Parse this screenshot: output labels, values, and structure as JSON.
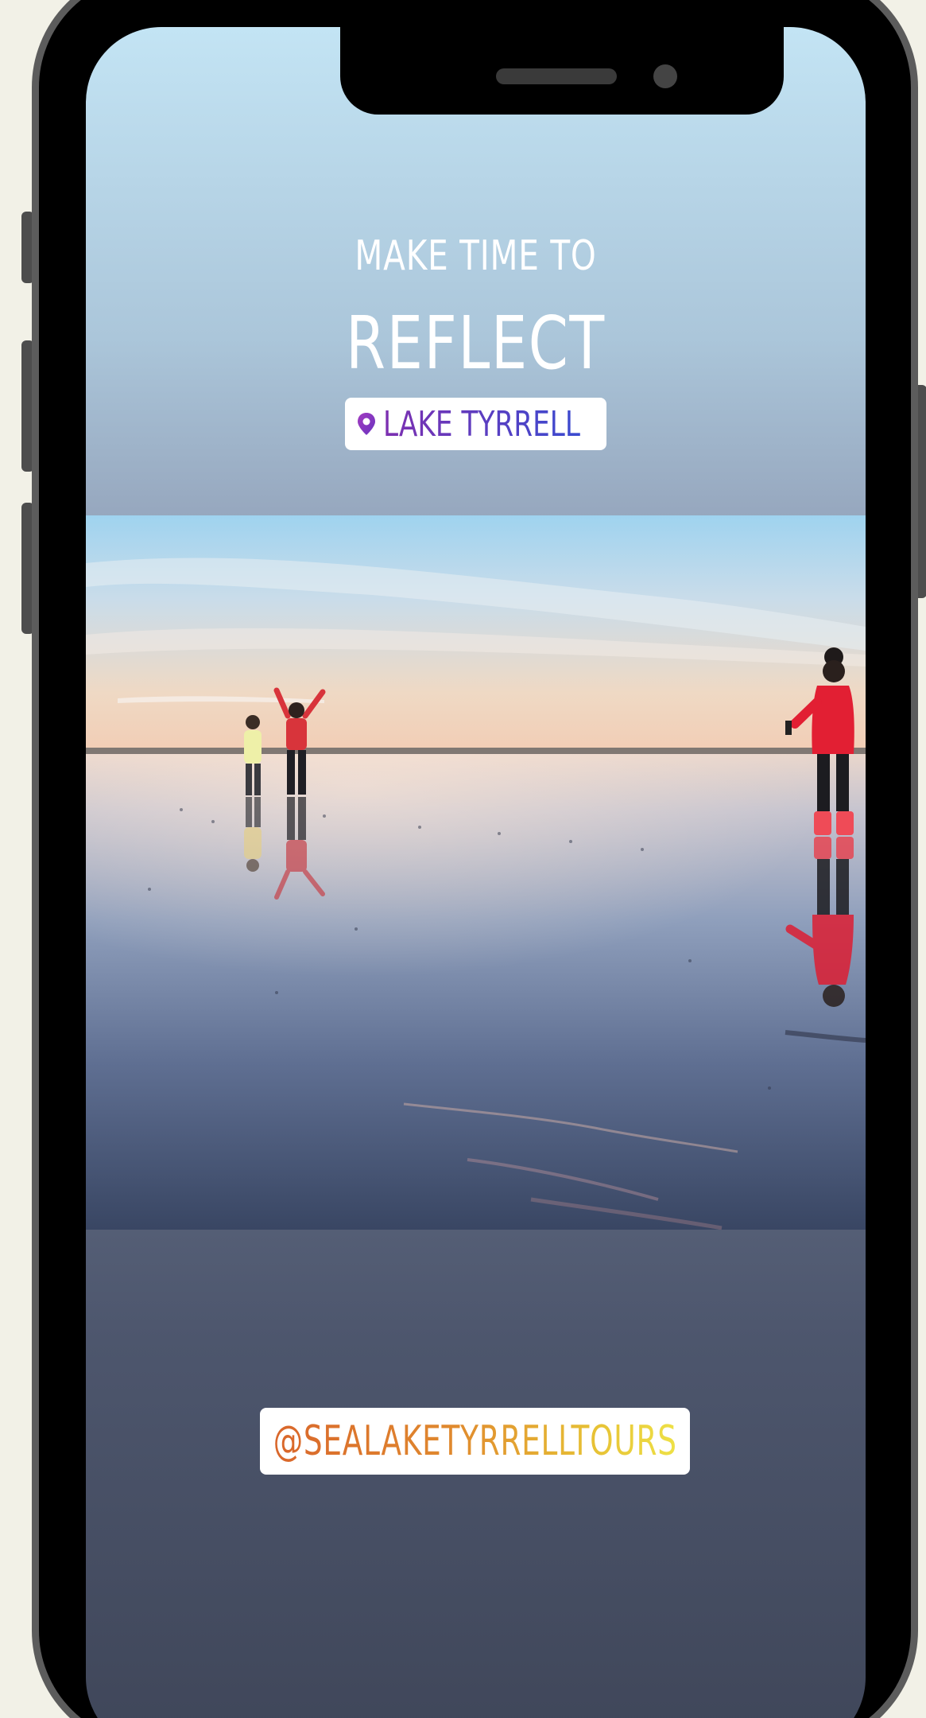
{
  "story": {
    "kicker": "MAKE TIME TO",
    "headline": "REFLECT",
    "location_sticker": {
      "icon": "location-pin-icon",
      "label": "LAKE TYRRELL",
      "color_start": "#7d2fb0",
      "color_end": "#3a4bd0"
    },
    "mention_sticker": {
      "label": "@SEALAKETYRRELLTOURS",
      "color_start": "#d9662b",
      "color_end": "#eee146"
    },
    "photo": {
      "subject": "three-people-on-salt-lake-reflection"
    }
  },
  "device": {
    "type": "phone-mockup",
    "frame_color": "#000000",
    "bezel_color": "#5c5c5c",
    "background": "#f2f1e7"
  }
}
